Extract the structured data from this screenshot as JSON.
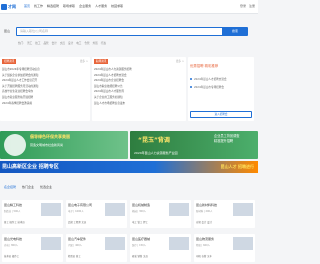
{
  "header": {
    "logo": "才网",
    "nav": [
      "首页",
      "找工作",
      "精选招聘",
      "职场求职",
      "企业服务",
      "人才服务",
      "校园求职"
    ],
    "right": [
      "登录",
      "注册"
    ]
  },
  "search": {
    "city": "昆山",
    "placeholder": "请输入职位/公司名称",
    "button": "搜索",
    "hotwords": [
      "热门:",
      "普工",
      "技工",
      "品管",
      "会计",
      "文员",
      "设计",
      "电工",
      "仓管",
      "外贸",
      "行政"
    ]
  },
  "news_cols": [
    {
      "tag": "招聘资讯",
      "more": "更多 >",
      "items": [
        "昆山市2024年专场招聘活动信息",
        "关于组织企业参加招聘会的通知",
        "2024年昆山人才工作会议召开",
        "关于开展招聘服务月活动的通知",
        "高校毕业生就业招聘会举办",
        "昆山市就业服务站开展招聘",
        "2024年春季招聘会邀请函"
      ]
    },
    {
      "tag": "职场资讯",
      "more": "更多 >",
      "items": [
        "2024年昆山市人力资源服务招聘",
        "2024年昆山人才招聘交流会",
        "2024年昆山市企业招聘会",
        "昆山市职业技能招聘公告",
        "2024年昆山市人才服务周",
        "关于企业用工服务的通知",
        "昆山人才市场招聘信息发布"
      ]
    }
  ],
  "notice": {
    "title": "优秀招聘 精彩推荐",
    "items": [
      "2024年昆山人才招聘交流会",
      "2024年昆山市专场招聘会"
    ],
    "button": "进入招聘会"
  },
  "banners": {
    "left_title": "倡导绿色环保共享美丽",
    "left_sub": "营造文明城市社会新风尚",
    "right_title": "“昆玉”背调",
    "right_side": [
      "企业员工背景调查",
      "精准提升招聘"
    ],
    "right_bottom": "2024年昆山人力资源服务产业园"
  },
  "ribbon": {
    "text": "昆山高新区企业 招聘专区",
    "right": "昆山人才 招聘进行"
  },
  "tabs": [
    "名企招聘",
    "热门企业",
    "优选企业"
  ],
  "companies": [
    {
      "name": "昆山精工科技",
      "meta": "制造业 | 500人",
      "job": "普工 操作工 技术员"
    },
    {
      "name": "昆山电子有限公司",
      "meta": "电子 | 1000人",
      "job": "品管 工程师 文员"
    },
    {
      "name": "昆山机械制造",
      "meta": "机械 | 300人",
      "job": "电工 钳工 焊工"
    },
    {
      "name": "昆山新材料科技",
      "meta": "新材料 | 200人",
      "job": "仓管 会计 设计"
    },
    {
      "name": "昆山光电科技",
      "meta": "光电 | 800人",
      "job": "技术员 操作工"
    },
    {
      "name": "昆山汽车配件",
      "meta": "汽配 | 400人",
      "job": "检验员 普工"
    },
    {
      "name": "昆山医疗器械",
      "meta": "医疗 | 150人",
      "job": "研发 销售 文员"
    },
    {
      "name": "昆山物流服务",
      "meta": "物流 | 600人",
      "job": "司机 仓管 叉车"
    }
  ]
}
